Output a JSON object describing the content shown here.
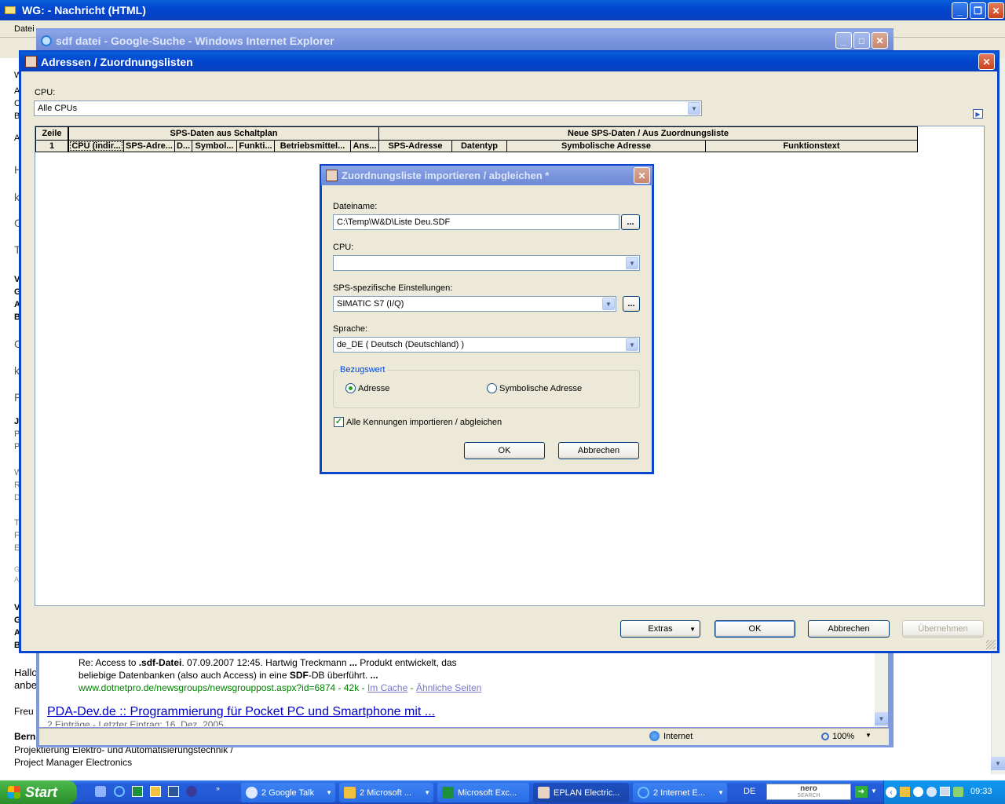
{
  "outlook": {
    "title": "WG:  - Nachricht (HTML)",
    "menu_first": "Datei",
    "left_letters": [
      "W",
      "A",
      "C",
      "Be",
      "A",
      "H",
      "k",
      "G",
      "T",
      "V",
      "G",
      "A",
      "B",
      "G",
      "k",
      "F",
      "J",
      "P",
      "P",
      "W",
      "R",
      "D",
      "T",
      "F",
      "E",
      "G",
      "A",
      "V",
      "G",
      "A",
      "B"
    ],
    "body_lines": [
      "Hallo",
      "anbe",
      "Freu",
      "Bern"
    ],
    "signature_line1": "Projektierung Elektro- und Automatisierungstechnik /",
    "signature_line2": "Project Manager Electronics"
  },
  "ie": {
    "title": "sdf datei - Google-Suche - Windows Internet Explorer",
    "result1_line1_prefix": "Re: Access to ",
    "result1_line1_bold": ".sdf-Datei",
    "result1_line1_rest": ". 07.09.2007 12:45. Hartwig Treckmann ",
    "result1_line1_dots": "...",
    "result1_line1_tail": " Produkt entwickelt, das",
    "result1_line2_prefix": "beliebige Datenbanken (also auch Access) in eine ",
    "result1_line2_bold": "SDF",
    "result1_line2_rest": "-DB überführt. ",
    "result1_line2_dots": "...",
    "result1_url": "www.dotnetpro.de/newsgroups/newsgrouppost.aspx?id=6874 - 42k - ",
    "result1_cache": "Im Cache",
    "result1_sep": " - ",
    "result1_similar": "Ähnliche Seiten",
    "result2_title": "PDA-Dev.de :: Programmierung für Pocket PC und Smartphone mit ...",
    "result2_sub": "2 Einträge - Letzter Eintrag: 16. Dez. 2005",
    "status_zone": "Internet",
    "zoom": "100%"
  },
  "main": {
    "title": "Adressen / Zuordnungslisten",
    "cpu_label": "CPU:",
    "cpu_value": "Alle CPUs",
    "grid": {
      "group_left": "SPS-Daten aus Schaltplan",
      "group_right": "Neue SPS-Daten / Aus Zuordnungsliste",
      "col_zeile": "Zeile",
      "row_num": "1",
      "left_cols": [
        "CPU (indir...",
        "SPS-Adre...",
        "D...",
        "Symbol...",
        "Funkti...",
        "Betriebsmittel...",
        "Ans..."
      ],
      "right_cols": [
        "SPS-Adresse",
        "Datentyp",
        "Symbolische Adresse",
        "Funktionstext"
      ]
    },
    "buttons": {
      "extras": "Extras",
      "ok": "OK",
      "cancel": "Abbrechen",
      "apply": "Übernehmen"
    }
  },
  "dialog": {
    "title": "Zuordnungsliste importieren / abgleichen *",
    "filename_label": "Dateiname:",
    "filename_value": "C:\\Temp\\W&D\\Liste Deu.SDF",
    "browse": "...",
    "cpu_label": "CPU:",
    "cpu_value": "",
    "plc_label": "SPS-spezifische Einstellungen:",
    "plc_value": "SIMATIC S7 (I/Q)",
    "lang_label": "Sprache:",
    "lang_value": "de_DE ( Deutsch (Deutschland) )",
    "group_label": "Bezugswert",
    "radio_address": "Adresse",
    "radio_symbolic": "Symbolische Adresse",
    "check_all": "Alle Kennungen importieren / abgleichen",
    "ok": "OK",
    "cancel": "Abbrechen"
  },
  "taskbar": {
    "start": "Start",
    "buttons": [
      "2 Google Talk",
      "2 Microsoft ...",
      "Microsoft Exc...",
      "EPLAN Electric...",
      "2 Internet E..."
    ],
    "lang": "DE",
    "nero": "nero",
    "nero_sub": "SEARCH",
    "clock": "09:33"
  }
}
